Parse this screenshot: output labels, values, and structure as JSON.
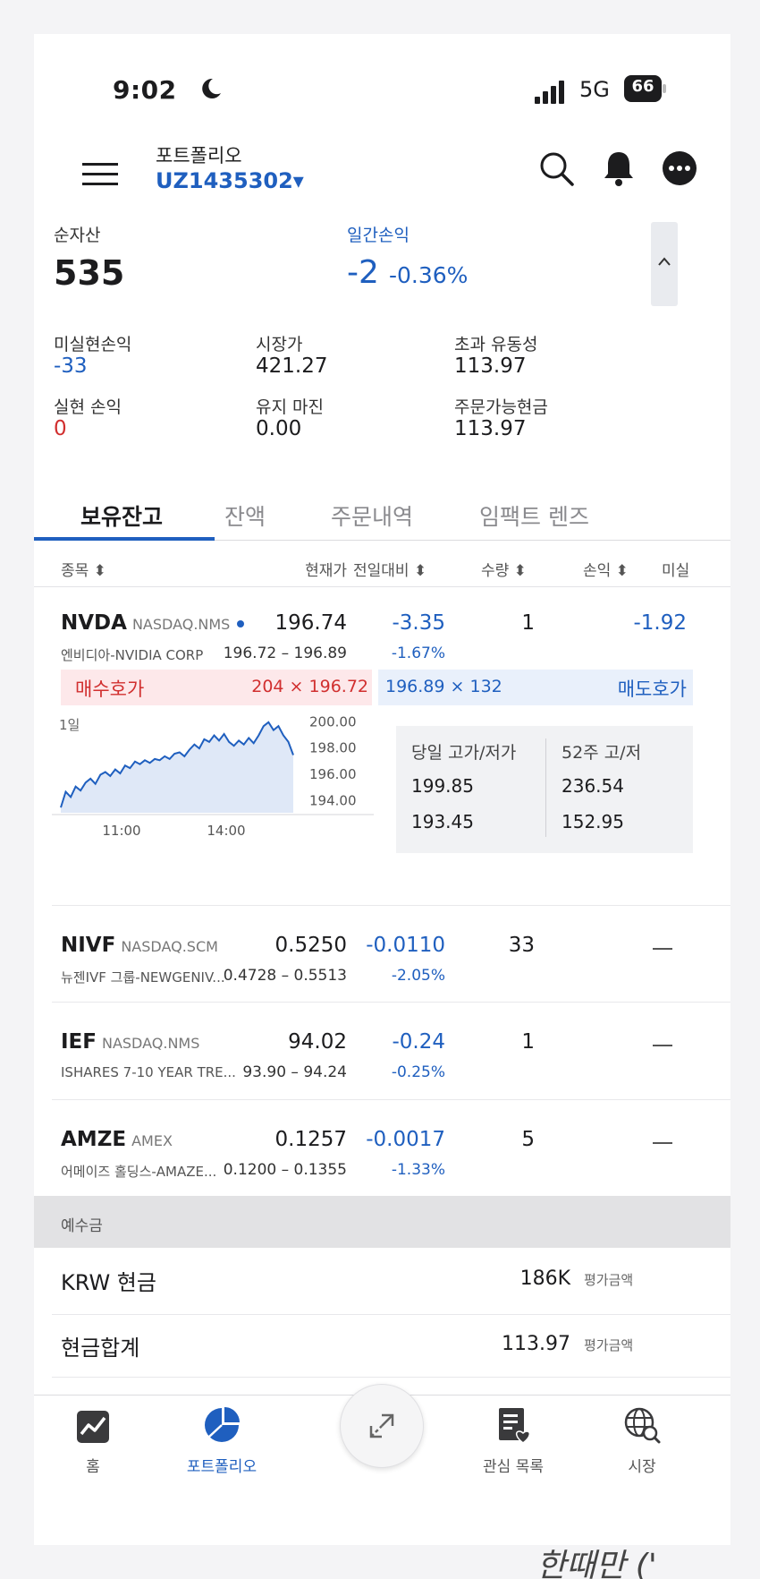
{
  "status": {
    "time": "9:02",
    "network": "5G",
    "battery": "66"
  },
  "header": {
    "subtitle": "포트폴리오",
    "account": "UZ1435302▾"
  },
  "summary": {
    "net_assets": {
      "label": "순자산",
      "value": "535"
    },
    "daily_pnl": {
      "label": "일간손익",
      "value": "-2",
      "percent": "-0.36%"
    },
    "metrics": [
      {
        "label": "미실현손익",
        "value": "-33",
        "tone": "neg"
      },
      {
        "label": "시장가",
        "value": "421.27",
        "tone": "none"
      },
      {
        "label": "초과 유동성",
        "value": "113.97",
        "tone": "none"
      },
      {
        "label": "실현 손익",
        "value": "0",
        "tone": "pos"
      },
      {
        "label": "유지 마진",
        "value": "0.00",
        "tone": "none"
      },
      {
        "label": "주문가능현금",
        "value": "113.97",
        "tone": "none"
      }
    ]
  },
  "tabs": [
    {
      "label": "보유잔고",
      "active": true
    },
    {
      "label": "잔액",
      "active": false
    },
    {
      "label": "주문내역",
      "active": false
    },
    {
      "label": "임팩트 렌즈",
      "active": false
    }
  ],
  "table_headers": {
    "symbol": "종목 ⬍",
    "price": "현재가",
    "change": "전일대비 ⬍",
    "qty": "수량 ⬍",
    "pnl": "손익 ⬍",
    "extra": "미실"
  },
  "holdings": [
    {
      "symbol": "NVDA",
      "exchange": "NASDAQ.NMS",
      "name": "엔비디아-NVIDIA CORP",
      "price": "196.74",
      "range": "196.72 – 196.89",
      "change": "-3.35",
      "change_pct": "-1.67%",
      "qty": "1",
      "pnl": "-1.92"
    },
    {
      "symbol": "NIVF",
      "exchange": "NASDAQ.SCM",
      "name": "뉴젠IVF 그룹-NEWGENIV...",
      "price": "0.5250",
      "range": "0.4728 – 0.5513",
      "change": "-0.0110",
      "change_pct": "-2.05%",
      "qty": "33",
      "pnl": "—"
    },
    {
      "symbol": "IEF",
      "exchange": "NASDAQ.NMS",
      "name": "ISHARES 7-10 YEAR TRE...",
      "price": "94.02",
      "range": "93.90 – 94.24",
      "change": "-0.24",
      "change_pct": "-0.25%",
      "qty": "1",
      "pnl": "—"
    },
    {
      "symbol": "AMZE",
      "exchange": "AMEX",
      "name": "어메이즈 홀딩스-AMAZE...",
      "price": "0.1257",
      "range": "0.1200 – 0.1355",
      "change": "-0.0017",
      "change_pct": "-1.33%",
      "qty": "5",
      "pnl": "—"
    }
  ],
  "quote": {
    "bid_label": "매수호가",
    "bid": "204 × 196.72",
    "ask": "196.89 × 132",
    "ask_label": "매도호가",
    "period": "1일",
    "day_hl_label": "당일 고가/저가",
    "day_high": "199.85",
    "day_low": "193.45",
    "wk52_label": "52주 고/저",
    "wk52_high": "236.54",
    "wk52_low": "152.95"
  },
  "mini_chart": {
    "y_ticks": [
      "200.00",
      "198.00",
      "196.00",
      "194.00"
    ],
    "x_ticks": [
      "11:00",
      "14:00"
    ],
    "y_range": [
      193.0,
      200.5
    ],
    "series": [
      193.4,
      194.6,
      194.2,
      195.0,
      194.7,
      195.3,
      195.6,
      195.2,
      195.9,
      196.1,
      195.8,
      196.3,
      196.0,
      196.6,
      196.4,
      196.9,
      196.7,
      197.0,
      196.8,
      197.1,
      197.0,
      197.3,
      197.1,
      197.5,
      197.6,
      197.3,
      197.8,
      198.2,
      197.9,
      198.6,
      198.4,
      198.9,
      198.5,
      199.0,
      198.4,
      198.1,
      198.5,
      198.2,
      198.7,
      198.3,
      198.9,
      199.6,
      199.9,
      199.3,
      199.6,
      198.9,
      198.4,
      197.4
    ],
    "color": "#1f5fbf"
  },
  "deposit": {
    "section_label": "예수금",
    "rows": [
      {
        "label": "KRW 현금",
        "value": "186K",
        "unit": "평가금액"
      },
      {
        "label": "현금합계",
        "value": "113.97",
        "unit": "평가금액"
      }
    ]
  },
  "nav": [
    {
      "label": "홈",
      "icon": "home-chart-icon",
      "active": false
    },
    {
      "label": "포트폴리오",
      "icon": "pie-chart-icon",
      "active": true
    },
    {
      "label": "관심 목록",
      "icon": "watchlist-icon",
      "active": false
    },
    {
      "label": "시장",
      "icon": "market-globe-icon",
      "active": false
    }
  ],
  "colors": {
    "accent": "#1f5fbf",
    "negative": "#1f5fbf",
    "positive": "#d12f2f"
  },
  "footer_text": "한때만 ('"
}
